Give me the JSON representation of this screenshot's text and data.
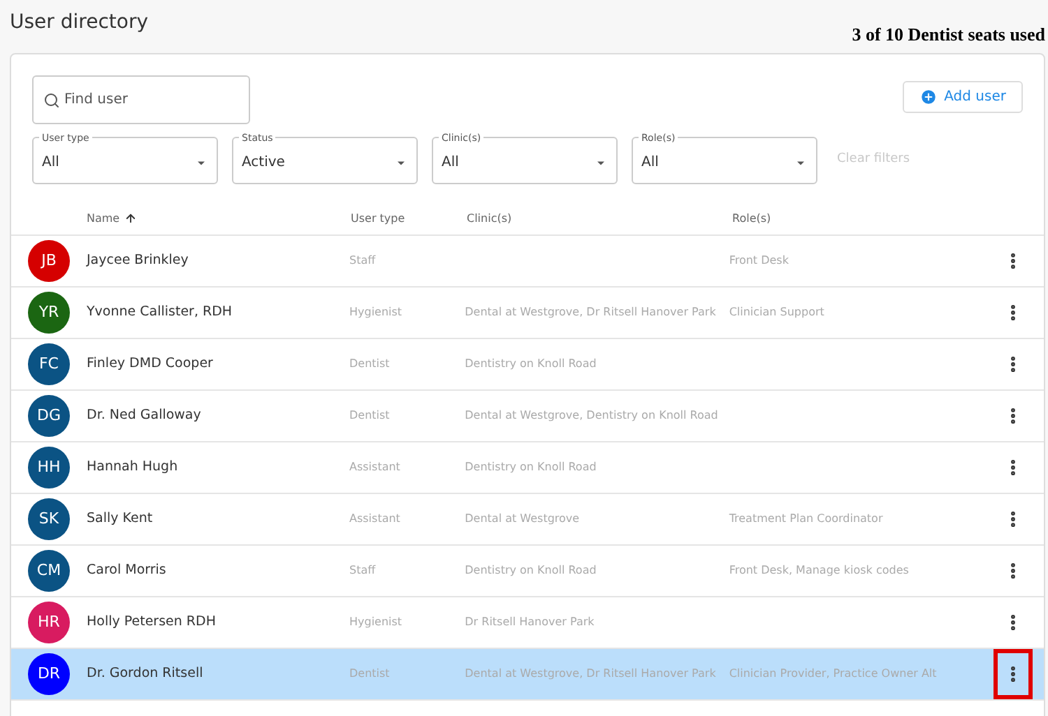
{
  "title": "User directory",
  "seats": "3 of 10 Dentist seats used",
  "search": {
    "placeholder": "Find user"
  },
  "add_button": "Add user",
  "filters": [
    {
      "label": "User type",
      "value": "All"
    },
    {
      "label": "Status",
      "value": "Active"
    },
    {
      "label": "Clinic(s)",
      "value": "All"
    },
    {
      "label": "Role(s)",
      "value": "All"
    }
  ],
  "clear_filters": "Clear filters",
  "columns": [
    {
      "label": "Name",
      "sorted": true
    },
    {
      "label": "User type",
      "sorted": false
    },
    {
      "label": "Clinic(s)",
      "sorted": false
    },
    {
      "label": "Role(s)",
      "sorted": false
    }
  ],
  "rows": [
    {
      "initials": "JB",
      "color": "#d50000",
      "name": "Jaycee Brinkley",
      "user_type": "Staff",
      "clinics": "",
      "roles": "Front Desk",
      "selected": false,
      "marked": false
    },
    {
      "initials": "YR",
      "color": "#1b6612",
      "name": "Yvonne Callister, RDH",
      "user_type": "Hygienist",
      "clinics": "Dental at Westgrove, Dr Ritsell Hanover Park",
      "roles": "Clinician Support",
      "selected": false,
      "marked": false
    },
    {
      "initials": "FC",
      "color": "#0b5384",
      "name": "Finley DMD Cooper",
      "user_type": "Dentist",
      "clinics": "Dentistry on Knoll Road",
      "roles": "",
      "selected": false,
      "marked": false
    },
    {
      "initials": "DG",
      "color": "#0b5384",
      "name": "Dr. Ned Galloway",
      "user_type": "Dentist",
      "clinics": "Dental at Westgrove, Dentistry on Knoll Road",
      "roles": "",
      "selected": false,
      "marked": false
    },
    {
      "initials": "HH",
      "color": "#0b5384",
      "name": "Hannah Hugh",
      "user_type": "Assistant",
      "clinics": "Dentistry on Knoll Road",
      "roles": "",
      "selected": false,
      "marked": false
    },
    {
      "initials": "SK",
      "color": "#0b5384",
      "name": "Sally Kent",
      "user_type": "Assistant",
      "clinics": "Dental at Westgrove",
      "roles": "Treatment Plan Coordinator",
      "selected": false,
      "marked": false
    },
    {
      "initials": "CM",
      "color": "#0b5384",
      "name": "Carol Morris",
      "user_type": "Staff",
      "clinics": "Dentistry on Knoll Road",
      "roles": "Front Desk, Manage kiosk codes",
      "selected": false,
      "marked": false
    },
    {
      "initials": "HR",
      "color": "#d81b60",
      "name": "Holly Petersen RDH",
      "user_type": "Hygienist",
      "clinics": "Dr Ritsell Hanover Park",
      "roles": "",
      "selected": false,
      "marked": false
    },
    {
      "initials": "DR",
      "color": "#0000ff",
      "name": "Dr. Gordon Ritsell",
      "user_type": "Dentist",
      "clinics": "Dental at Westgrove, Dr Ritsell Hanover Park",
      "roles": "Clinician Provider, Practice Owner Alt",
      "selected": true,
      "marked": true
    }
  ]
}
